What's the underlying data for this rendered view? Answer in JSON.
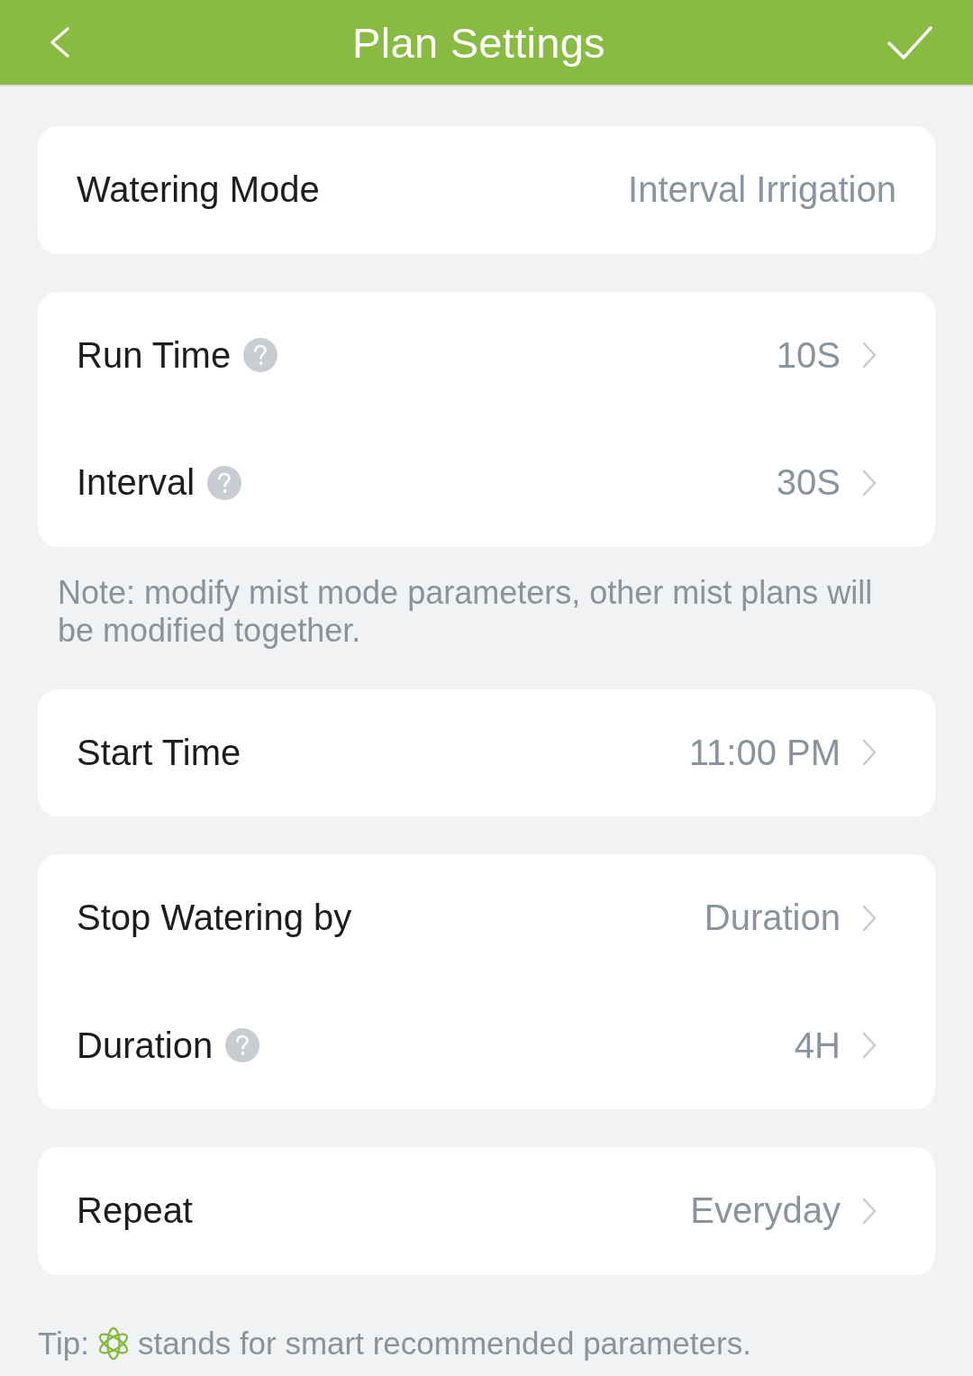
{
  "header": {
    "title": "Plan Settings"
  },
  "sections": [
    {
      "kind": "card",
      "rows": [
        {
          "label": "Watering Mode",
          "value": "Interval Irrigation",
          "help": false,
          "chevron": false
        }
      ]
    },
    {
      "kind": "card",
      "rows": [
        {
          "label": "Run Time",
          "value": "10S",
          "help": true,
          "chevron": true
        },
        {
          "label": "Interval",
          "value": "30S",
          "help": true,
          "chevron": true
        }
      ]
    },
    {
      "kind": "note",
      "text": "Note: modify mist mode parameters, other mist plans will be modified together."
    },
    {
      "kind": "card",
      "rows": [
        {
          "label": "Start Time",
          "value": "11:00 PM",
          "help": false,
          "chevron": true
        }
      ]
    },
    {
      "kind": "card",
      "rows": [
        {
          "label": "Stop Watering by",
          "value": "Duration",
          "help": false,
          "chevron": true
        },
        {
          "label": "Duration",
          "value": "4H",
          "help": true,
          "chevron": true
        }
      ]
    },
    {
      "kind": "card",
      "rows": [
        {
          "label": "Repeat",
          "value": "Everyday",
          "help": false,
          "chevron": true
        }
      ]
    }
  ],
  "tip": {
    "lead": "Tip:",
    "text": "stands for smart recommended parameters."
  }
}
